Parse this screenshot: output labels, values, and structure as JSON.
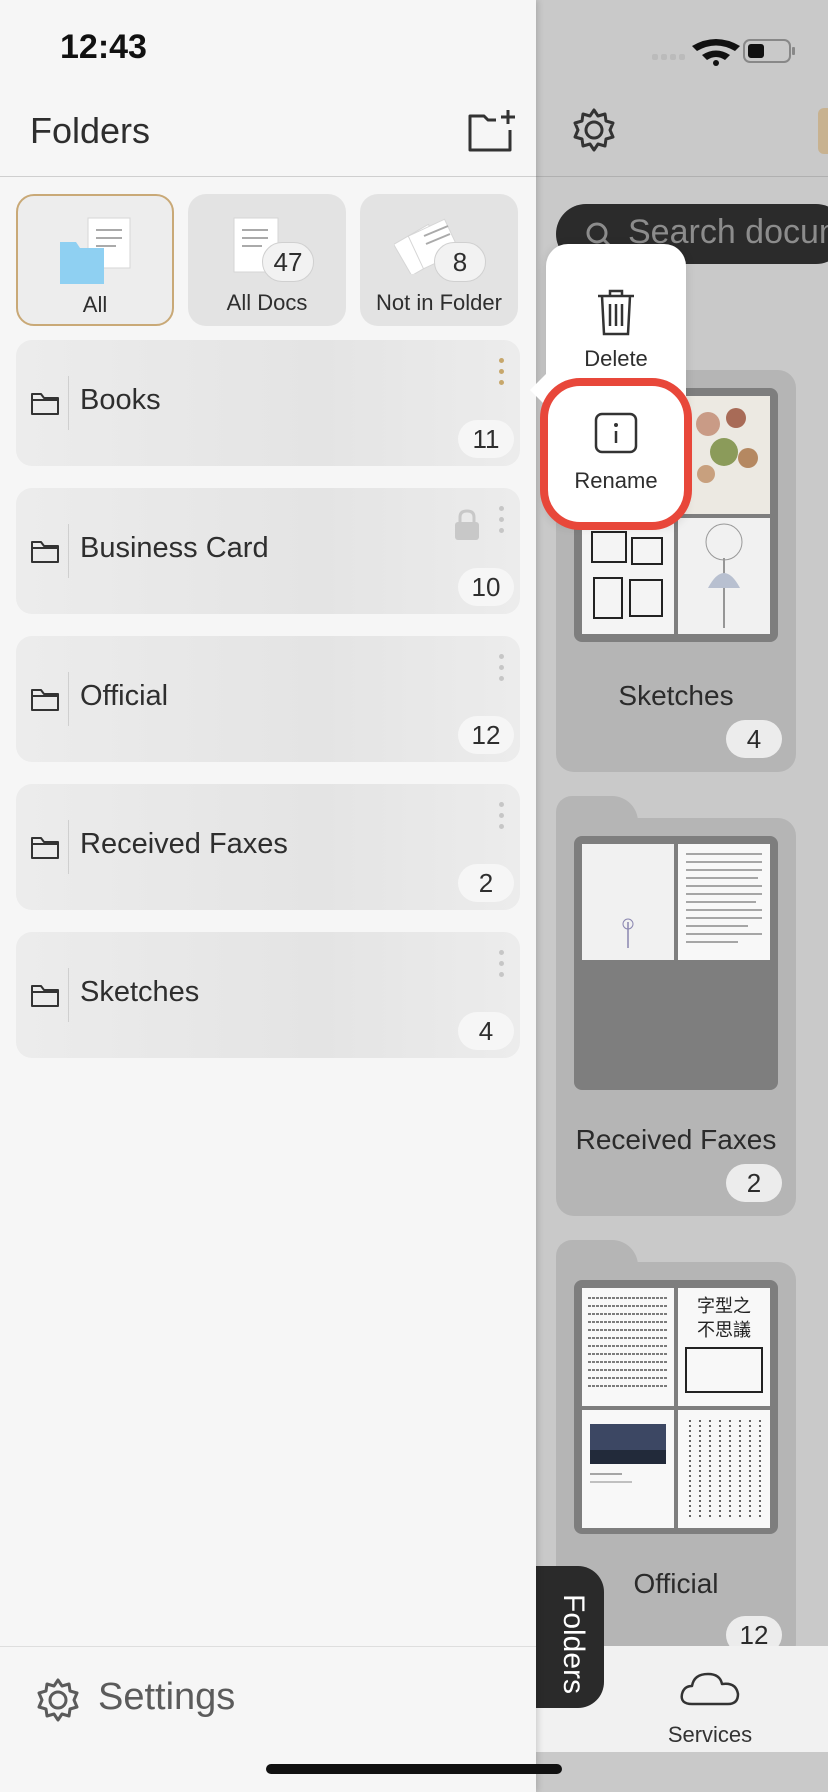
{
  "status_bar": {
    "time": "12:43"
  },
  "drawer": {
    "title": "Folders",
    "categories": [
      {
        "label": "All",
        "count": ""
      },
      {
        "label": "All Docs",
        "count": "47"
      },
      {
        "label": "Not in Folder",
        "count": "8"
      }
    ],
    "folders": [
      {
        "name": "Books",
        "count": "11",
        "locked": false
      },
      {
        "name": "Business Card",
        "count": "10",
        "locked": true
      },
      {
        "name": "Official",
        "count": "12",
        "locked": false
      },
      {
        "name": "Received Faxes",
        "count": "2",
        "locked": false
      },
      {
        "name": "Sketches",
        "count": "4",
        "locked": false
      }
    ],
    "settings_label": "Settings"
  },
  "context_menu": {
    "delete_label": "Delete",
    "rename_label": "Rename"
  },
  "background": {
    "search_placeholder": "Search docum",
    "folders_tab_label": "Folders",
    "services_label": "Services",
    "cards": [
      {
        "name": "Sketches",
        "count": "4"
      },
      {
        "name": "Received Faxes",
        "count": "2"
      },
      {
        "name": "Official",
        "count": "12"
      }
    ]
  },
  "colors": {
    "accent": "#c9a977",
    "highlight": "#e8473a",
    "folder_blue": "#8fd0f2"
  }
}
